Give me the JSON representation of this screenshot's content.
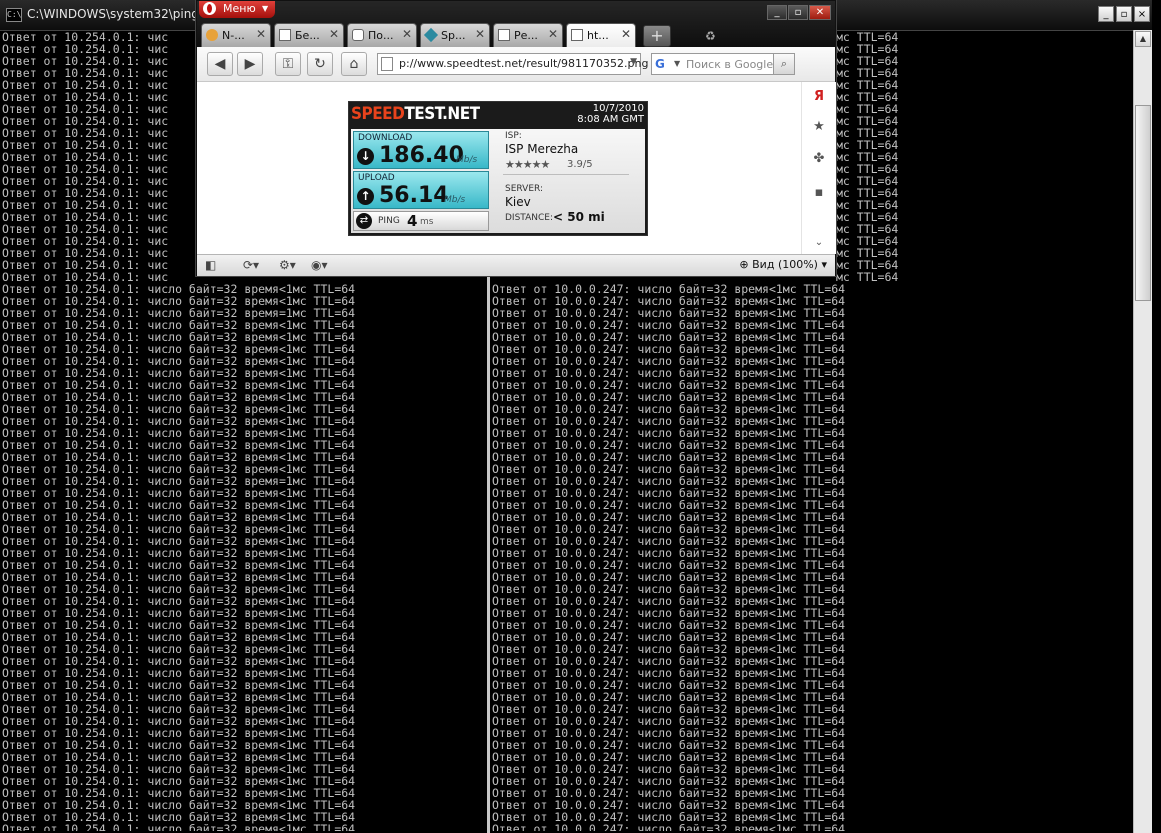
{
  "cmd": {
    "title": "C:\\WINDOWS\\system32\\ping.e",
    "icon_text": "C:\\",
    "controls": [
      "_",
      "▫",
      "×"
    ],
    "left_lines": [
      "Ответ от 10.254.0.1: чис",
      "Ответ от 10.254.0.1: чис",
      "Ответ от 10.254.0.1: чис",
      "Ответ от 10.254.0.1: чис",
      "Ответ от 10.254.0.1: чис",
      "Ответ от 10.254.0.1: чис",
      "Ответ от 10.254.0.1: чис",
      "Ответ от 10.254.0.1: чис",
      "Ответ от 10.254.0.1: чис",
      "Ответ от 10.254.0.1: чис",
      "Ответ от 10.254.0.1: чис",
      "Ответ от 10.254.0.1: чис",
      "Ответ от 10.254.0.1: чис",
      "Ответ от 10.254.0.1: чис",
      "Ответ от 10.254.0.1: чис",
      "Ответ от 10.254.0.1: чис",
      "Ответ от 10.254.0.1: чис",
      "Ответ от 10.254.0.1: чис",
      "Ответ от 10.254.0.1: чис",
      "Ответ от 10.254.0.1: чис",
      "Ответ от 10.254.0.1: чис",
      "Ответ от 10.254.0.1: число байт=32 время<1мс TTL=64",
      "Ответ от 10.254.0.1: число байт=32 время<1мс TTL=64",
      "Ответ от 10.254.0.1: число байт=32 время=1мс TTL=64",
      "Ответ от 10.254.0.1: число байт=32 время<1мс TTL=64",
      "Ответ от 10.254.0.1: число байт=32 время<1мс TTL=64",
      "Ответ от 10.254.0.1: число байт=32 время<1мс TTL=64",
      "Ответ от 10.254.0.1: число байт=32 время<1мс TTL=64",
      "Ответ от 10.254.0.1: число байт=32 время<1мс TTL=64",
      "Ответ от 10.254.0.1: число байт=32 время<1мс TTL=64",
      "Ответ от 10.254.0.1: число байт=32 время<1мс TTL=64",
      "Ответ от 10.254.0.1: число байт=32 время<1мс TTL=64",
      "Ответ от 10.254.0.1: число байт=32 время<1мс TTL=64",
      "Ответ от 10.254.0.1: число байт=32 время<1мс TTL=64",
      "Ответ от 10.254.0.1: число байт=32 время<1мс TTL=64",
      "Ответ от 10.254.0.1: число байт=32 время<1мс TTL=64",
      "Ответ от 10.254.0.1: число байт=32 время<1мс TTL=64",
      "Ответ от 10.254.0.1: число байт=32 время=1мс TTL=64",
      "Ответ от 10.254.0.1: число байт=32 время<1мс TTL=64",
      "Ответ от 10.254.0.1: число байт=32 время<1мс TTL=64",
      "Ответ от 10.254.0.1: число байт=32 время<1мс TTL=64",
      "Ответ от 10.254.0.1: число байт=32 время<1мс TTL=64",
      "Ответ от 10.254.0.1: число байт=32 время<1мс TTL=64",
      "Ответ от 10.254.0.1: число байт=32 время<1мс TTL=64",
      "Ответ от 10.254.0.1: число байт=32 время<1мс TTL=64",
      "Ответ от 10.254.0.1: число байт=32 время<1мс TTL=64",
      "Ответ от 10.254.0.1: число байт=32 время<1мс TTL=64",
      "Ответ от 10.254.0.1: число байт=32 время<1мс TTL=64",
      "Ответ от 10.254.0.1: число байт=32 время<1мс TTL=64",
      "Ответ от 10.254.0.1: число байт=32 время<1мс TTL=64",
      "Ответ от 10.254.0.1: число байт=32 время<1мс TTL=64",
      "Ответ от 10.254.0.1: число байт=32 время<1мс TTL=64",
      "Ответ от 10.254.0.1: число байт=32 время<1мс TTL=64",
      "Ответ от 10.254.0.1: число байт=32 время<1мс TTL=64",
      "Ответ от 10.254.0.1: число байт=32 время<1мс TTL=64",
      "Ответ от 10.254.0.1: число байт=32 время<1мс TTL=64",
      "Ответ от 10.254.0.1: число байт=32 время<1мс TTL=64",
      "Ответ от 10.254.0.1: число байт=32 время<1мс TTL=64",
      "Ответ от 10.254.0.1: число байт=32 время<1мс TTL=64",
      "Ответ от 10.254.0.1: число байт=32 время<1мс TTL=64",
      "Ответ от 10.254.0.1: число байт=32 время<1мс TTL=64",
      "Ответ от 10.254.0.1: число байт=32 время<1мс TTL=64",
      "Ответ от 10.254.0.1: число байт=32 время<1мс TTL=64",
      "Ответ от 10.254.0.1: число байт=32 время<1мс TTL=64",
      "Ответ от 10.254.0.1: число байт=32 время<1мс TTL=64",
      "Ответ от 10.254.0.1: число байт=32 время<1мс TTL=64",
      "Ответ от 10.254.0.1: число байт=32 время<1мс TTL=64"
    ],
    "right_lines_top": [
      "мс TTL=64",
      "мс TTL=64",
      "мс TTL=64",
      "мс TTL=64",
      "мс TTL=64",
      "мс TTL=64",
      "мс TTL=64",
      "мс TTL=64",
      "мс TTL=64",
      "мс TTL=64",
      "мс TTL=64",
      "мс TTL=64",
      "мс TTL=64",
      "мс TTL=64",
      "мс TTL=64",
      "мс TTL=64",
      "мс TTL=64",
      "мс TTL=64",
      "мс TTL=64",
      "мс TTL=64",
      "мс TTL=64"
    ],
    "right_lines": [
      "Ответ от 10.0.0.247: число байт=32 время<1мс TTL=64",
      "Ответ от 10.0.0.247: число байт=32 время<1мс TTL=64",
      "Ответ от 10.0.0.247: число байт=32 время<1мс TTL=64",
      "Ответ от 10.0.0.247: число байт=32 время<1мс TTL=64",
      "Ответ от 10.0.0.247: число байт=32 время<1мс TTL=64",
      "Ответ от 10.0.0.247: число байт=32 время<1мс TTL=64",
      "Ответ от 10.0.0.247: число байт=32 время<1мс TTL=64",
      "Ответ от 10.0.0.247: число байт=32 время<1мс TTL=64",
      "Ответ от 10.0.0.247: число байт=32 время<1мс TTL=64",
      "Ответ от 10.0.0.247: число байт=32 время<1мс TTL=64",
      "Ответ от 10.0.0.247: число байт=32 время<1мс TTL=64",
      "Ответ от 10.0.0.247: число байт=32 время<1мс TTL=64",
      "Ответ от 10.0.0.247: число байт=32 время<1мс TTL=64",
      "Ответ от 10.0.0.247: число байт=32 время<1мс TTL=64",
      "Ответ от 10.0.0.247: число байт=32 время<1мс TTL=64",
      "Ответ от 10.0.0.247: число байт=32 время<1мс TTL=64",
      "Ответ от 10.0.0.247: число байт=32 время<1мс TTL=64",
      "Ответ от 10.0.0.247: число байт=32 время<1мс TTL=64",
      "Ответ от 10.0.0.247: число байт=32 время<1мс TTL=64",
      "Ответ от 10.0.0.247: число байт=32 время<1мс TTL=64",
      "Ответ от 10.0.0.247: число байт=32 время<1мс TTL=64",
      "Ответ от 10.0.0.247: число байт=32 время<1мс TTL=64",
      "Ответ от 10.0.0.247: число байт=32 время<1мс TTL=64",
      "Ответ от 10.0.0.247: число байт=32 время<1мс TTL=64",
      "Ответ от 10.0.0.247: число байт=32 время<1мс TTL=64",
      "Ответ от 10.0.0.247: число байт=32 время<1мс TTL=64",
      "Ответ от 10.0.0.247: число байт=32 время<1мс TTL=64",
      "Ответ от 10.0.0.247: число байт=32 время<1мс TTL=64",
      "Ответ от 10.0.0.247: число байт=32 время<1мс TTL=64",
      "Ответ от 10.0.0.247: число байт=32 время<1мс TTL=64",
      "Ответ от 10.0.0.247: число байт=32 время<1мс TTL=64",
      "Ответ от 10.0.0.247: число байт=32 время<1мс TTL=64",
      "Ответ от 10.0.0.247: число байт=32 время<1мс TTL=64",
      "Ответ от 10.0.0.247: число байт=32 время<1мс TTL=64",
      "Ответ от 10.0.0.247: число байт=32 время<1мс TTL=64",
      "Ответ от 10.0.0.247: число байт=32 время<1мс TTL=64",
      "Ответ от 10.0.0.247: число байт=32 время<1мс TTL=64",
      "Ответ от 10.0.0.247: число байт=32 время<1мс TTL=64",
      "Ответ от 10.0.0.247: число байт=32 время<1мс TTL=64",
      "Ответ от 10.0.0.247: число байт=32 время<1мс TTL=64",
      "Ответ от 10.0.0.247: число байт=32 время<1мс TTL=64",
      "Ответ от 10.0.0.247: число байт=32 время<1мс TTL=64",
      "Ответ от 10.0.0.247: число байт=32 время<1мс TTL=64",
      "Ответ от 10.0.0.247: число байт=32 время<1мс TTL=64",
      "Ответ от 10.0.0.247: число байт=32 время<1мс TTL=64",
      "Ответ от 10.0.0.247: число байт=32 время<1мс TTL=64"
    ]
  },
  "browser": {
    "menu_label": "Меню",
    "tabs": [
      {
        "label": "N-...",
        "icon": "globe-icon",
        "active": false
      },
      {
        "label": "Бе...",
        "icon": "page-icon",
        "active": false
      },
      {
        "label": "По...",
        "icon": "page-icon",
        "active": false
      },
      {
        "label": "Sp...",
        "icon": "diamond-icon",
        "active": false
      },
      {
        "label": "Ре...",
        "icon": "page-icon",
        "active": false
      },
      {
        "label": "ht...",
        "icon": "page-icon",
        "active": true
      }
    ],
    "tab_close": "✕",
    "add_tab": "+",
    "address": "p://www.speedtest.net/result/981170352.png",
    "search_placeholder": "Поиск в Google",
    "zoom_label": "Вид (100%)"
  },
  "speedtest": {
    "logo_part1": "SPEED",
    "logo_part2": "TEST.NET",
    "date": "10/7/2010",
    "time": "8:08 AM GMT",
    "download_label": "DOWNLOAD",
    "download_value": "186.40",
    "download_unit": "Mb/s",
    "upload_label": "UPLOAD",
    "upload_value": "56.14",
    "upload_unit": "Mb/s",
    "ping_label": "PING",
    "ping_value": "4",
    "ping_unit": "ms",
    "isp_label": "ISP:",
    "isp_value": "ISP Merezha",
    "stars": "★★★★★",
    "rating": "3.9/5",
    "server_label": "SERVER:",
    "server_value": "Kiev",
    "distance_label": "DISTANCE:",
    "distance_value": "< 50 mi"
  },
  "colors": {
    "accent": "#e8431c",
    "meter": "#38b8c8",
    "terminal_text": "#c0c0c0"
  }
}
